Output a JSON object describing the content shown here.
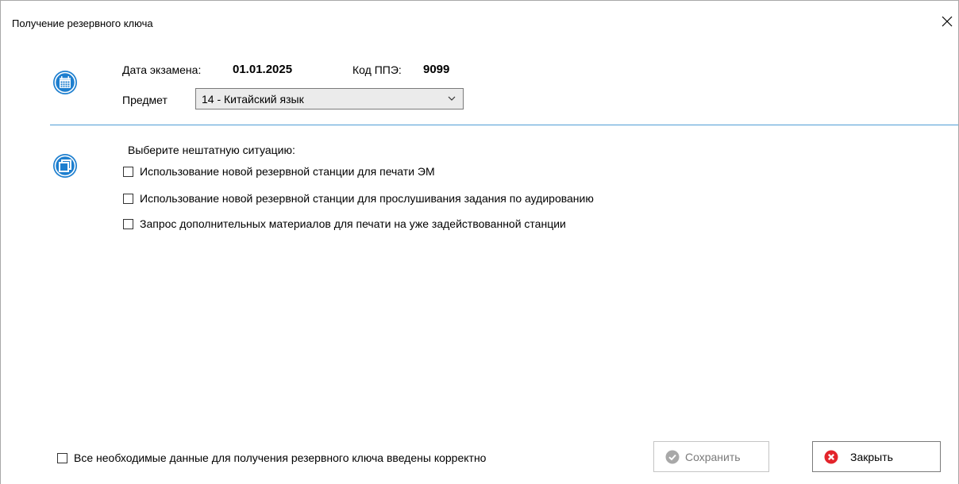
{
  "window": {
    "title": "Получение резервного ключа",
    "close_glyph": "×"
  },
  "exam": {
    "date_label": "Дата экзамена:",
    "date_value": "01.01.2025",
    "ppe_label": "Код ППЭ:",
    "ppe_value": "9099",
    "subject_label": "Предмет",
    "subject_selected": "14 - Китайский язык"
  },
  "situation": {
    "heading": "Выберите нештатную ситуацию:",
    "options": [
      {
        "label": "Использование новой резервной станции для печати ЭМ",
        "checked": false
      },
      {
        "label": "Использование новой резервной станции для прослушивания задания по аудированию",
        "checked": false
      },
      {
        "label": "Запрос дополнительных материалов для печати на уже задействованной станции",
        "checked": false
      }
    ]
  },
  "footer": {
    "confirm_label": "Все необходимые данные для получения резервного ключа введены корректно",
    "confirm_checked": false,
    "save_label": "Сохранить",
    "close_label": "Закрыть"
  },
  "icons": {
    "calendar": "calendar-icon",
    "windows": "copy-windows-icon",
    "save": "check-circle-icon",
    "close": "error-x-circle-icon"
  },
  "colors": {
    "accent": "#1e7fcf",
    "divider": "#4f9dd6",
    "close_red": "#e3242b",
    "disabled_gray": "#a8a8a8"
  }
}
